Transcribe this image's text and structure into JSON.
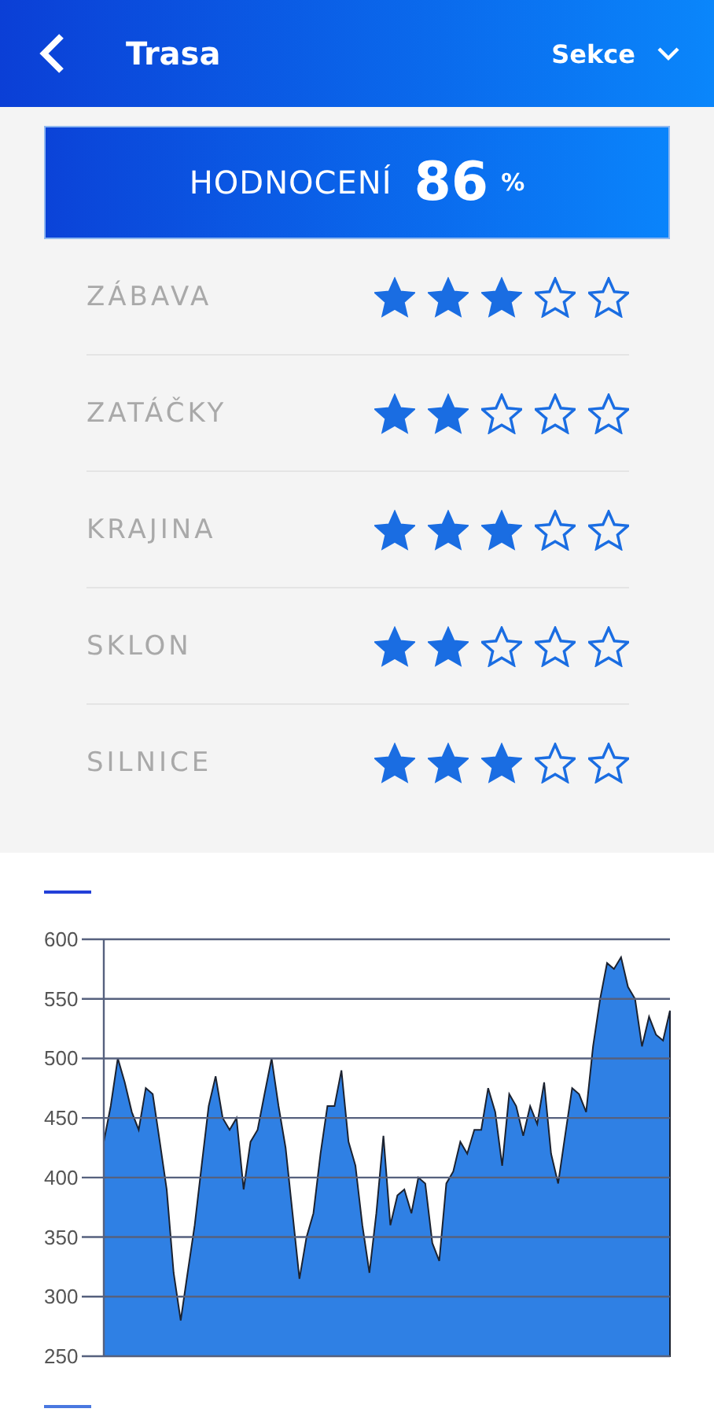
{
  "header": {
    "title": "Trasa",
    "section": "Sekce"
  },
  "rating": {
    "label": "HODNOCENÍ",
    "value": "86",
    "unit": "%"
  },
  "criteria": [
    {
      "label": "ZÁBAVA",
      "stars": 3
    },
    {
      "label": "ZATÁČKY",
      "stars": 2
    },
    {
      "label": "KRAJINA",
      "stars": 3
    },
    {
      "label": "SKLON",
      "stars": 2
    },
    {
      "label": "SILNICE",
      "stars": 3
    }
  ],
  "chart_data": {
    "type": "area",
    "grid": true,
    "ylim": [
      250,
      600
    ],
    "yticks": [
      250,
      300,
      350,
      400,
      450,
      500,
      550,
      600
    ],
    "series": [
      {
        "color": "#2f80e4",
        "values": [
          430,
          460,
          500,
          480,
          455,
          440,
          475,
          470,
          430,
          390,
          320,
          280,
          320,
          360,
          410,
          460,
          485,
          450,
          440,
          450,
          390,
          430,
          440,
          470,
          500,
          460,
          425,
          370,
          315,
          350,
          370,
          420,
          460,
          460,
          490,
          430,
          410,
          360,
          320,
          370,
          435,
          360,
          385,
          390,
          370,
          400,
          395,
          345,
          330,
          395,
          405,
          430,
          420,
          440,
          440,
          475,
          455,
          410,
          470,
          460,
          435,
          460,
          445,
          480,
          420,
          395,
          435,
          475,
          470,
          455,
          510,
          550,
          580,
          575,
          585,
          560,
          550,
          510,
          535,
          520,
          515,
          540
        ]
      }
    ]
  }
}
